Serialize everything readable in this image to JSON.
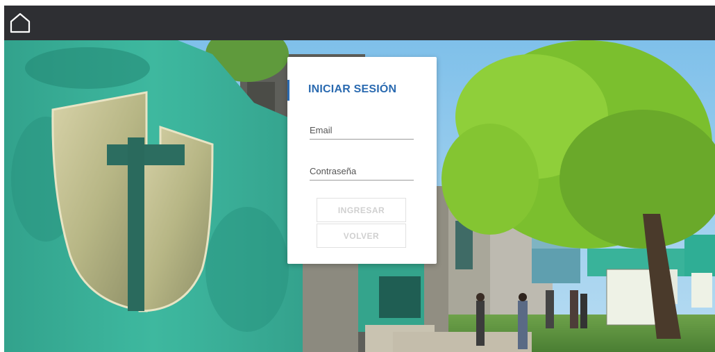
{
  "topbar": {
    "home_icon": "home-icon"
  },
  "login": {
    "title": "INICIAR SESIÓN",
    "email_placeholder": "Email",
    "password_placeholder": "Contraseña",
    "submit_label": "INGRESAR",
    "back_label": "VOLVER"
  },
  "colors": {
    "topbar": "#2e2f33",
    "accent": "#2a6ab0",
    "wall": "#2fae95"
  }
}
